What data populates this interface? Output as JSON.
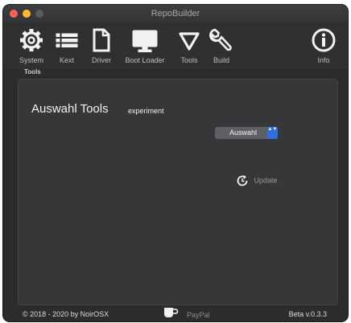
{
  "window": {
    "title": "RepoBuilder"
  },
  "toolbar": {
    "items": [
      {
        "label": "System",
        "icon": "gear-icon"
      },
      {
        "label": "Kext",
        "icon": "list-icon"
      },
      {
        "label": "Driver",
        "icon": "document-icon"
      },
      {
        "label": "Boot Loader",
        "icon": "monitor-icon"
      },
      {
        "label": "Tools",
        "icon": "triangle-icon"
      },
      {
        "label": "Build",
        "icon": "wrench-icon"
      },
      {
        "label": "Info",
        "icon": "info-icon"
      }
    ]
  },
  "tab": {
    "caption": "Tools"
  },
  "main": {
    "title": "Auswahl Tools",
    "subtitle": "experiment",
    "select": {
      "value": "Auswahl",
      "arrows": "▲▼"
    },
    "update_label": "Update"
  },
  "footer": {
    "copyright": "© 2018 - 2020 by NoirOSX",
    "paypal": "PayPal",
    "version": "Beta v.0.3.3"
  },
  "colors": {
    "accent": "#2f6fe0",
    "window_bg": "#2b2c2e",
    "panel_bg": "#363739"
  }
}
